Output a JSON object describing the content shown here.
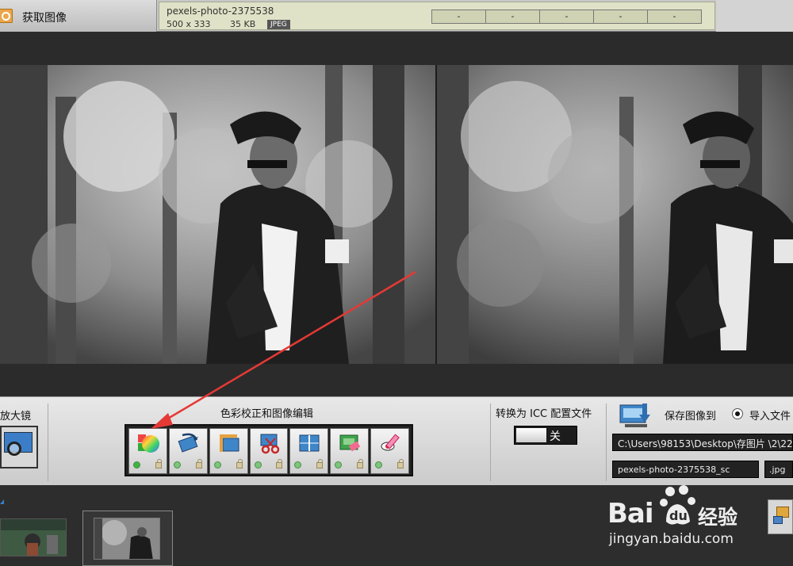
{
  "toolbar_top": {
    "acquire_label": "获取图像",
    "file_name": "pexels-photo-2375538",
    "dimensions": "500 x 333",
    "file_size": "35 KB",
    "format_badge": "JPEG",
    "slots": [
      "-",
      "-",
      "-",
      "-",
      "-"
    ]
  },
  "panel": {
    "magnifier_title": "放大镜",
    "color_edit_title": "色彩校正和图像编辑",
    "tools": [
      {
        "name": "color-correction-tool",
        "icon": "color-wheel-icon",
        "active": true
      },
      {
        "name": "rotate-tool",
        "icon": "rotate-icon",
        "active": false
      },
      {
        "name": "crop-tool",
        "icon": "crop-icon",
        "active": false
      },
      {
        "name": "cut-tool",
        "icon": "scissors-icon",
        "active": false
      },
      {
        "name": "split-tool",
        "icon": "split-view-icon",
        "active": false
      },
      {
        "name": "retouch-tool",
        "icon": "eraser-icon",
        "active": false
      },
      {
        "name": "red-eye-tool",
        "icon": "red-eye-icon",
        "active": false
      }
    ],
    "icc_title": "转换为 ICC 配置文件",
    "icc_toggle": "关",
    "save_title": "保存图像到",
    "import_label": "导入文件",
    "save_path": "C:\\Users\\98153\\Desktop\\存图片 \\2\\22\\",
    "save_name": "pexels-photo-2375538_sc",
    "save_ext": ".jpg"
  },
  "watermark": {
    "brand": "Bai",
    "brand_tail": "经验",
    "url": "jingyan.baidu.com"
  },
  "colors": {
    "accent_arrow": "#e53935",
    "panel_bg": "#dcdcdc",
    "dark_bg": "#2b2b2b"
  }
}
